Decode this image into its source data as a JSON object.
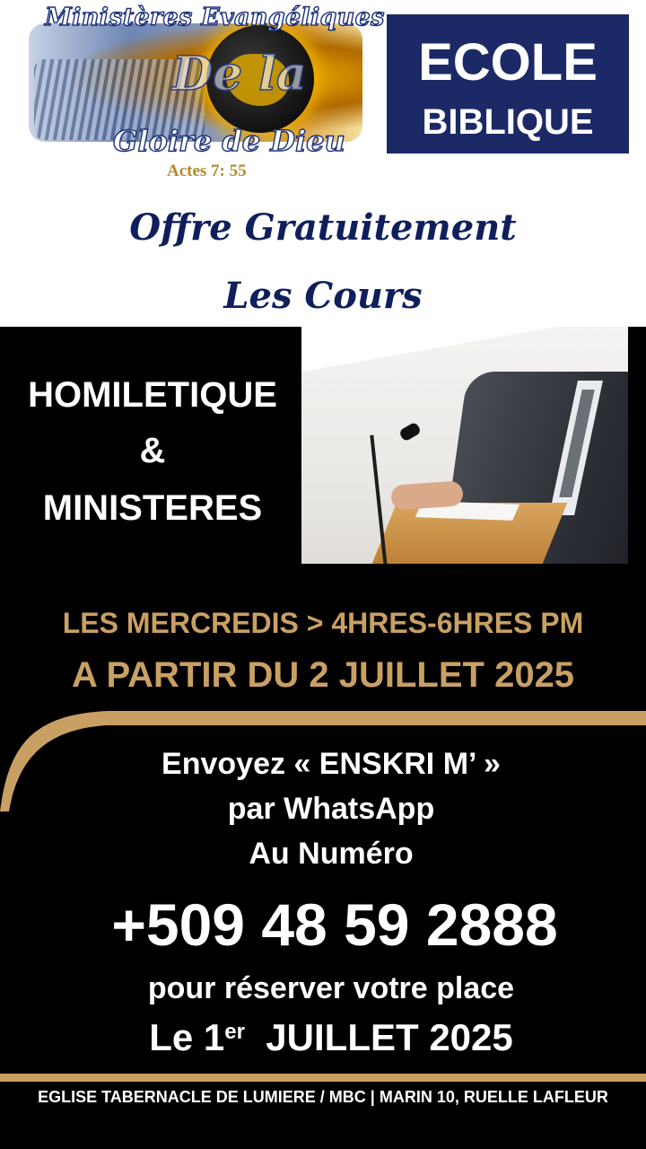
{
  "logo": {
    "title": "Ministères Evangéliques",
    "middle": "De la",
    "subtitle": "Gloire de Dieu",
    "verse": "Actes 7: 55"
  },
  "badge": {
    "line1": "ECOLE",
    "line2": "BIBLIQUE",
    "color": "#1b2a66"
  },
  "offer": {
    "line1": "Offre Gratuitement",
    "line2": "Les Cours"
  },
  "course": {
    "line1": "HOMILETIQUE",
    "line2": "&",
    "line3": "MINISTERES"
  },
  "photo": {
    "icon": "preacher-at-podium-photo"
  },
  "schedule": {
    "days_time": "LES MERCREDIS  > 4HRES-6HRES PM",
    "start": "A PARTIR DU 2 JUILLET 2025",
    "color": "#c9a063"
  },
  "signup": {
    "line1": "Envoyez « ENSKRI M’ »",
    "line2": "par WhatsApp",
    "line3": "Au Numéro",
    "phone": "+509 48 59 2888",
    "line4": "pour réserver votre place",
    "deadline_prefix": "Le 1",
    "deadline_sup": "er",
    "deadline_suffix": "  JUILLET 2025"
  },
  "footer": {
    "text": "EGLISE TABERNACLE DE LUMIERE / MBC | MARIN 10, RUELLE LAFLEUR"
  }
}
